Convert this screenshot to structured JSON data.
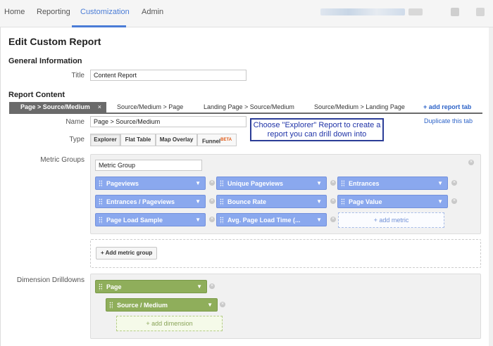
{
  "nav": {
    "items": [
      "Home",
      "Reporting",
      "Customization",
      "Admin"
    ],
    "active": "Customization"
  },
  "page": {
    "title": "Edit Custom Report"
  },
  "general": {
    "heading": "General Information",
    "title_label": "Title",
    "title_value": "Content Report"
  },
  "report_content": {
    "heading": "Report Content",
    "tabs": [
      "Page > Source/Medium",
      "Source/Medium > Page",
      "Landing Page > Source/Medium",
      "Source/Medium > Landing Page"
    ],
    "active_tab_close": "×",
    "add_tab": "+ add report tab",
    "name_label": "Name",
    "name_value": "Page > Source/Medium",
    "duplicate": "Duplicate this tab",
    "type_label": "Type",
    "types": [
      "Explorer",
      "Flat Table",
      "Map Overlay",
      "Funnel"
    ],
    "funnel_badge": "BETA",
    "callout": "Choose \"Explorer\" Report to create a report you can drill down into"
  },
  "metrics": {
    "label": "Metric Groups",
    "group_name": "Metric Group",
    "pills": [
      "Pageviews",
      "Unique Pageviews",
      "Entrances",
      "Entrances / Pageviews",
      "Bounce Rate",
      "Page Value",
      "Page Load Sample",
      "Avg. Page Load Time (..."
    ],
    "add_metric": "+ add metric",
    "add_group": "+ Add metric group"
  },
  "dimensions": {
    "label": "Dimension Drilldowns",
    "pills": [
      "Page",
      "Source / Medium"
    ],
    "add_dimension": "+ add dimension"
  },
  "colors": {
    "accent": "#4a7cd6",
    "metric_pill": "#8aa8ee",
    "dimension_pill": "#8fae5b",
    "callout_border": "#2b3d97"
  },
  "icons": [
    "grip-icon",
    "caret-down-icon",
    "remove-icon",
    "close-icon"
  ]
}
